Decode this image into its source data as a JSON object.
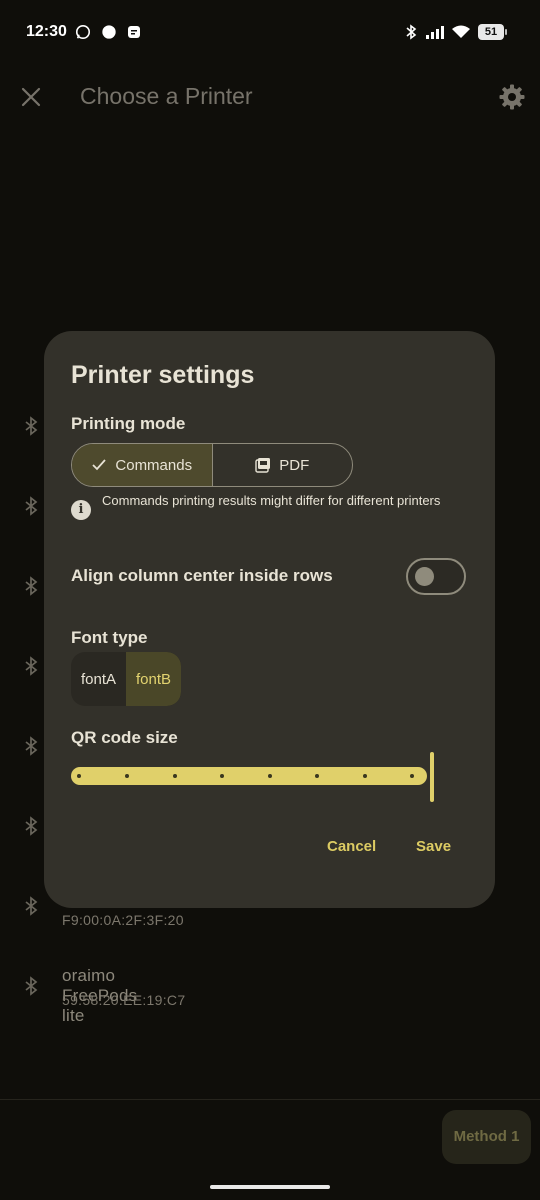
{
  "status_bar": {
    "time": "12:30",
    "battery": "51"
  },
  "app_bar": {
    "title": "Choose a Printer"
  },
  "devices": [
    {
      "addr": "F9:00:0A:2F:3F:20"
    },
    {
      "name": "oraimo FreePods lite",
      "addr": "59:58:20:EE:19:C7"
    }
  ],
  "dialog": {
    "title": "Printer settings",
    "printing_mode_label": "Printing mode",
    "modes": [
      "Commands",
      "PDF"
    ],
    "selected_mode": "Commands",
    "info_text": "Commands printing results might differ for different printers",
    "align_label": "Align column center inside rows",
    "align_enabled": false,
    "font_type_label": "Font type",
    "font_options": [
      "fontA",
      "fontB"
    ],
    "selected_font": "fontB",
    "qr_label": "QR code size",
    "qr_size_fraction": 1.0,
    "cancel_label": "Cancel",
    "save_label": "Save"
  },
  "bottom": {
    "method_label": "Method 1"
  },
  "colors": {
    "accent": "#e0d06a",
    "dialog_bg": "#33312a",
    "background": "#0f0e0a"
  }
}
